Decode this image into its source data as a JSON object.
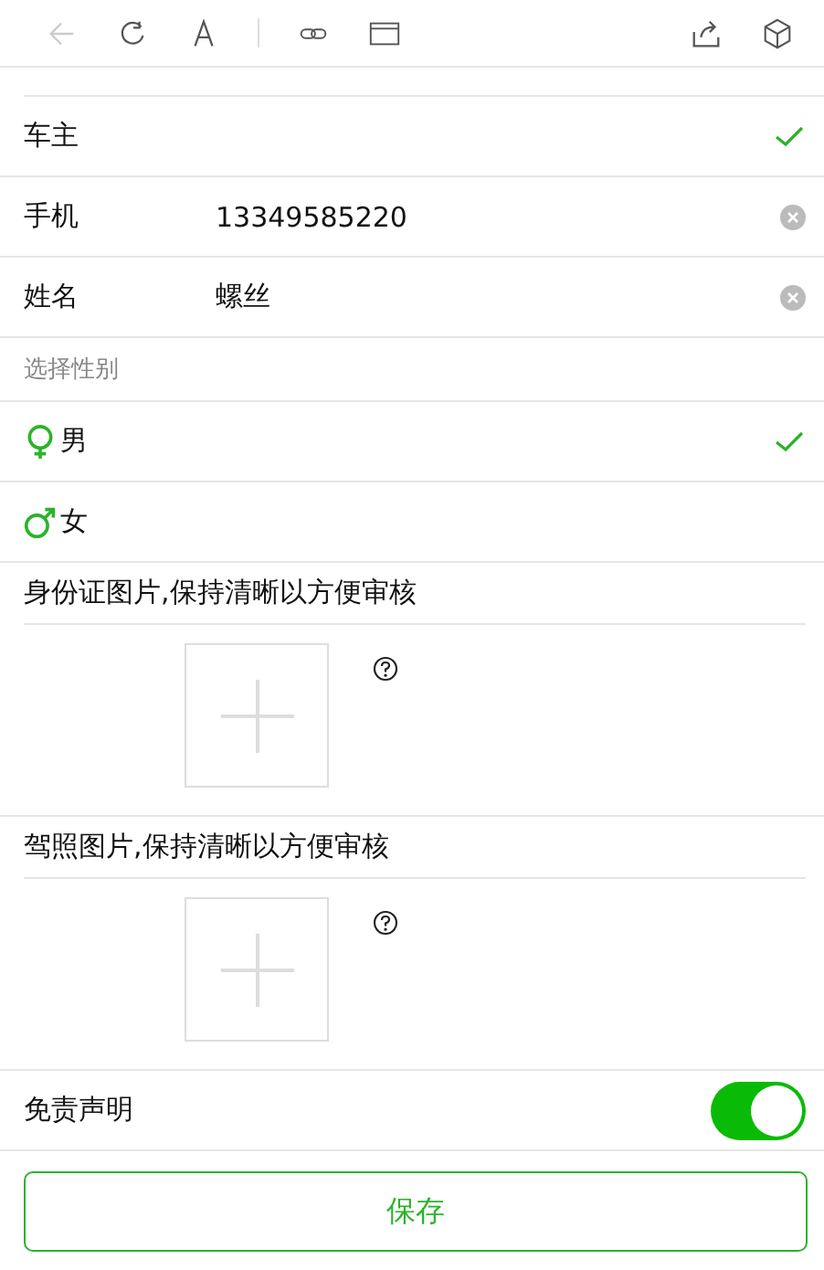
{
  "owner": {
    "label": "车主",
    "checked": true
  },
  "fields": [
    {
      "label": "手机",
      "value": "13349585220"
    },
    {
      "label": "姓名",
      "value": "螺丝"
    }
  ],
  "gender": {
    "title": "选择性别",
    "options": [
      {
        "label": "男",
        "kind": "venus",
        "selected": true
      },
      {
        "label": "女",
        "kind": "mars",
        "selected": false
      }
    ]
  },
  "uploads": [
    {
      "title": "身份证图片,保持清晰以方便审核"
    },
    {
      "title": "驾照图片,保持清晰以方便审核"
    }
  ],
  "disclaimer": {
    "label": "免责声明",
    "on": true
  },
  "save_button": "保存"
}
